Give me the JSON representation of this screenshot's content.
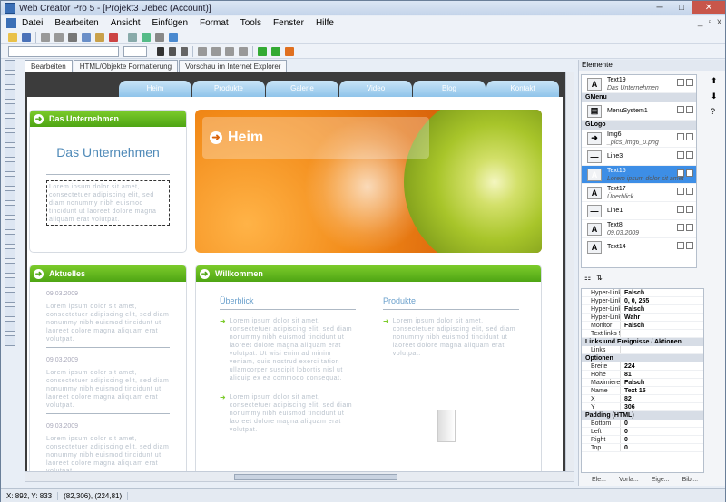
{
  "window": {
    "title": "Web Creator Pro 5 - [Projekt3 Uebec (Account)]"
  },
  "menu": {
    "items": [
      "Datei",
      "Bearbeiten",
      "Ansicht",
      "Einfügen",
      "Format",
      "Tools",
      "Fenster",
      "Hilfe"
    ]
  },
  "tabs": [
    "Bearbeiten",
    "HTML/Objekte Formatierung",
    "Vorschau im Internet Explorer"
  ],
  "site": {
    "nav": [
      "Heim",
      "Produkte",
      "Galerie",
      "Video",
      "Blog",
      "Kontakt"
    ],
    "unternehmen": {
      "header": "Das Unternehmen",
      "title": "Das Unternehmen",
      "text": "Lorem ipsum dolor sit amet, consectetuer adipiscing elit, sed diam nonummy nibh euismod tincidunt ut laoreet dolore magna aliquam erat volutpat."
    },
    "hero": {
      "label": "Heim"
    },
    "aktuelles": {
      "header": "Aktuelles",
      "items": [
        {
          "date": "09.03.2009",
          "text": "Lorem ipsum dolor sit amet, consectetuer adipiscing elit, sed diam nonummy nibh euismod tincidunt ut laoreet dolore magna aliquam erat volutpat."
        },
        {
          "date": "09.03.2009",
          "text": "Lorem ipsum dolor sit amet, consectetuer adipiscing elit, sed diam nonummy nibh euismod tincidunt ut laoreet dolore magna aliquam erat volutpat."
        },
        {
          "date": "09.03.2009",
          "text": "Lorem ipsum dolor sit amet, consectetuer adipiscing elit, sed diam nonummy nibh euismod tincidunt ut laoreet dolore magna aliquam erat volutpat."
        }
      ]
    },
    "willkommen": {
      "header": "Willkommen",
      "ueberblick": {
        "title": "Überblick",
        "text1": "Lorem ipsum dolor sit amet, consectetuer adipiscing elit, sed diam nonummy nibh euismod tincidunt ut laoreet dolore magna aliquam erat volutpat. Ut wisi enim ad minim veniam, quis nostrud exerci tation ullamcorper suscipit lobortis nisl ut aliquip ex ea commodo consequat.",
        "text2": "Lorem ipsum dolor sit amet, consectetuer adipiscing elit, sed diam nonummy nibh euismod tincidunt ut laoreet dolore magna aliquam erat volutpat."
      },
      "produkte": {
        "title": "Produkte",
        "text": "Lorem ipsum dolor sit amet, consectetuer adipiscing elit, sed diam nonummy nibh euismod tincidunt ut laoreet dolore magna aliquam erat volutpat."
      }
    }
  },
  "elements": {
    "title": "Elemente",
    "rows": [
      {
        "kind": "item",
        "icon": "A",
        "name": "Text19",
        "sub": "Das Unternehmen"
      },
      {
        "kind": "group",
        "name": "GMenu"
      },
      {
        "kind": "item",
        "icon": "▤",
        "name": "MenuSystem1",
        "sub": ""
      },
      {
        "kind": "group",
        "name": "GLogo"
      },
      {
        "kind": "item",
        "icon": "➜",
        "name": "Img6",
        "sub": "_pics_img6_0.png"
      },
      {
        "kind": "item",
        "icon": "—",
        "name": "Line3",
        "sub": ""
      },
      {
        "kind": "item",
        "icon": "A",
        "name": "Text15",
        "sub": "Lorem ipsum dolor sit amet",
        "selected": true
      },
      {
        "kind": "item",
        "icon": "A",
        "name": "Text17",
        "sub": "Überblick"
      },
      {
        "kind": "item",
        "icon": "—",
        "name": "Line1",
        "sub": ""
      },
      {
        "kind": "item",
        "icon": "A",
        "name": "Text8",
        "sub": "09.03.2009"
      },
      {
        "kind": "item",
        "icon": "A",
        "name": "Text14",
        "sub": ""
      }
    ]
  },
  "properties": {
    "rows": [
      {
        "kind": "prop",
        "k": "Hyper-Link Sch",
        "v": "Falsch"
      },
      {
        "kind": "prop",
        "k": "Hyper-Link Col",
        "v": "0, 0, 255"
      },
      {
        "kind": "prop",
        "k": "Hyper-Link text",
        "v": "Falsch"
      },
      {
        "kind": "prop",
        "k": "Hyper-Link Und",
        "v": "Wahr"
      },
      {
        "kind": "prop",
        "k": "Monitor",
        "v": "Falsch"
      },
      {
        "kind": "prop",
        "k": "Text links 5 Wahr",
        "v": ""
      },
      {
        "kind": "group",
        "k": "Links und Ereignisse / Aktionen"
      },
      {
        "kind": "prop",
        "k": "Links",
        "v": ""
      },
      {
        "kind": "group",
        "k": "Optionen"
      },
      {
        "kind": "prop",
        "k": "Breite",
        "v": "224"
      },
      {
        "kind": "prop",
        "k": "Höhe",
        "v": "81"
      },
      {
        "kind": "prop",
        "k": "Maximieren",
        "v": "Falsch"
      },
      {
        "kind": "prop",
        "k": "Name",
        "v": "Text 15"
      },
      {
        "kind": "prop",
        "k": "X",
        "v": "82"
      },
      {
        "kind": "prop",
        "k": "Y",
        "v": "306"
      },
      {
        "kind": "group",
        "k": "Padding (HTML)"
      },
      {
        "kind": "prop",
        "k": "Bottom",
        "v": "0"
      },
      {
        "kind": "prop",
        "k": "Left",
        "v": "0"
      },
      {
        "kind": "prop",
        "k": "Right",
        "v": "0"
      },
      {
        "kind": "prop",
        "k": "Top",
        "v": "0"
      }
    ]
  },
  "right_tabs": [
    "Ele...",
    "Vorla...",
    "Eige...",
    "Bibl..."
  ],
  "status": {
    "pos": "X: 892, Y: 833",
    "coords": "(82,306), (224,81)"
  }
}
